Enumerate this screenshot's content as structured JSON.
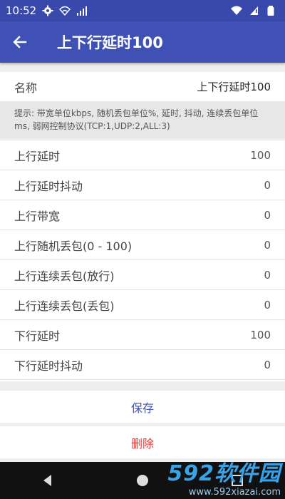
{
  "status_bar": {
    "time": "10:52",
    "left_icons": [
      "gear-icon",
      "wifi-off-icon",
      "signal-icon"
    ],
    "right_icons": [
      "wifi-icon",
      "sim-warning-icon",
      "battery-icon"
    ]
  },
  "app_bar": {
    "back_icon": "arrow-left-icon",
    "title": "上下行延时100"
  },
  "name_row": {
    "label": "名称",
    "value": "上下行延时100"
  },
  "hint": "提示: 带宽单位kbps, 随机丢包单位%, 延时, 抖动, 连续丢包单位ms, 弱网控制协议(TCP:1,UDP:2,ALL:3)",
  "params": [
    {
      "label": "上行延时",
      "value": "100"
    },
    {
      "label": "上行延时抖动",
      "value": "0"
    },
    {
      "label": "上行带宽",
      "value": "0"
    },
    {
      "label": "上行随机丢包(0 - 100)",
      "value": "0"
    },
    {
      "label": "上行连续丢包(放行)",
      "value": "0"
    },
    {
      "label": "上行连续丢包(丢包)",
      "value": "0"
    },
    {
      "label": "下行延时",
      "value": "100"
    },
    {
      "label": "下行延时抖动",
      "value": "0"
    }
  ],
  "buttons": {
    "save": "保存",
    "delete": "删除"
  },
  "nav_bar": {
    "icons": [
      "back-triangle-icon",
      "home-circle-icon",
      "recents-square-icon"
    ]
  },
  "watermark": {
    "logo": "592软件园",
    "url": "www.592xiazai.com"
  },
  "colors": {
    "status_bar": "#3949ab",
    "app_bar": "#3f51b5",
    "save": "#3f51b5",
    "delete": "#e53935"
  }
}
